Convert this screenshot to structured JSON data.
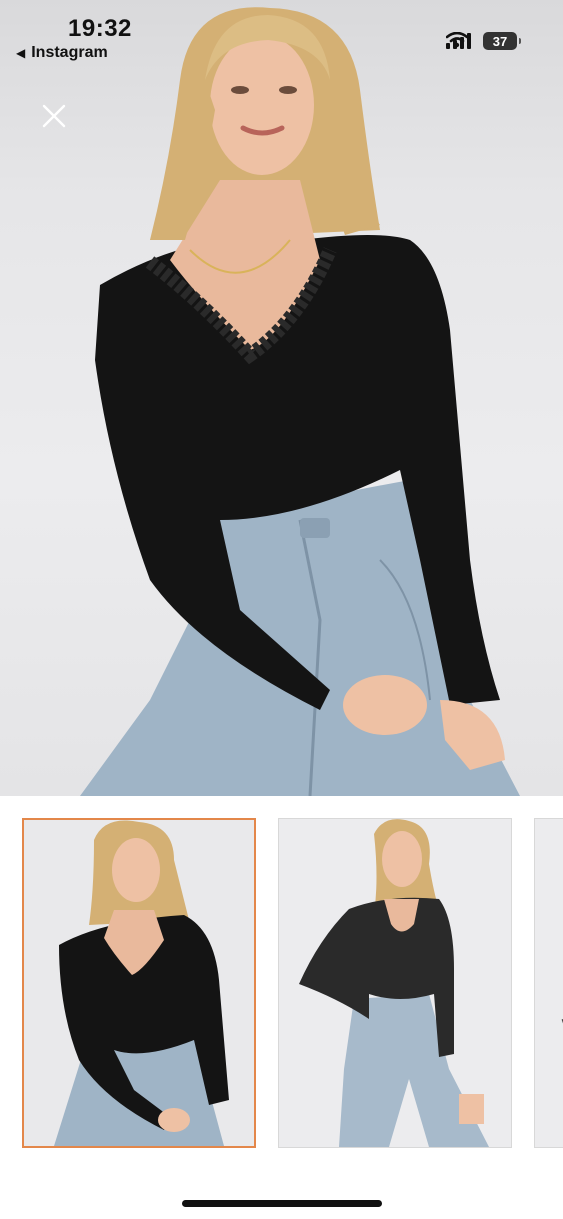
{
  "status_bar": {
    "time": "19:32",
    "back_app": "Instagram",
    "back_icon": "back-arrow-icon",
    "battery": "37",
    "icons": [
      "signal-icon",
      "wifi-icon",
      "battery-icon"
    ]
  },
  "viewer": {
    "close_icon": "close-icon",
    "main_image": "model in black lace v-neck long-sleeve top and light blue jeans",
    "selected_index": 0
  },
  "thumbnails": [
    {
      "image": "model front pose black top",
      "selected": true
    },
    {
      "image": "model hand on hip black top ripped jeans",
      "selected": false
    },
    {
      "image": "partial thumbnail",
      "selected": false
    }
  ],
  "colors": {
    "accent_selected_border": "#e3874a",
    "background": "#ffffff",
    "photo_background": "#e6e6e8"
  }
}
